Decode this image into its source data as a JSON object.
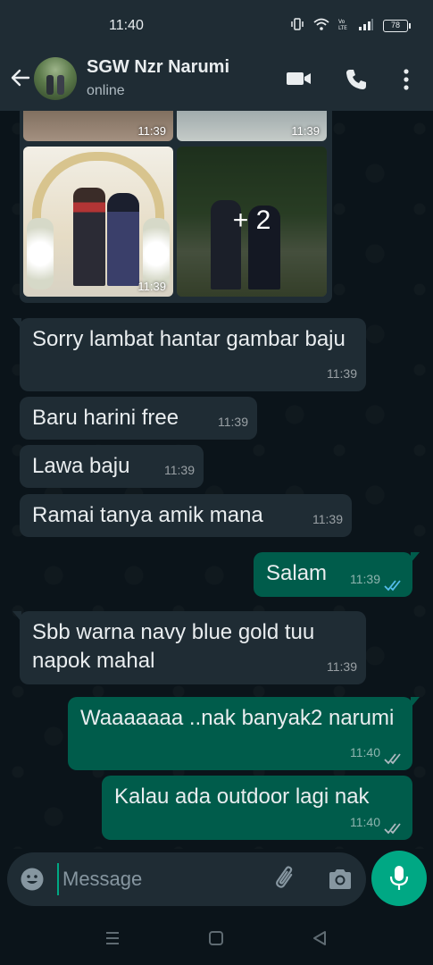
{
  "status_bar": {
    "time": "11:40",
    "battery": "78"
  },
  "header": {
    "name": "SGW Nzr Narumi",
    "status": "online"
  },
  "media": {
    "photo_times": [
      "11:39",
      "11:39",
      "11:39"
    ],
    "more_count": "+ 2"
  },
  "messages": [
    {
      "direction": "in",
      "text": "Sorry lambat hantar gambar baju",
      "time": "11:39"
    },
    {
      "direction": "in",
      "text": "Baru harini free",
      "time": "11:39"
    },
    {
      "direction": "in",
      "text": "Lawa baju",
      "time": "11:39"
    },
    {
      "direction": "in",
      "text": "Ramai tanya amik mana",
      "time": "11:39"
    },
    {
      "direction": "out",
      "text": "Salam",
      "time": "11:39",
      "ticks": "read"
    },
    {
      "direction": "in",
      "text": "Sbb warna navy blue gold tuu napok mahal",
      "time": "11:39"
    },
    {
      "direction": "out",
      "text": "Waaaaaaa ..nak banyak2 narumi",
      "time": "11:40",
      "ticks": "delivered"
    },
    {
      "direction": "out",
      "text": "Kalau ada outdoor lagi nak",
      "time": "11:40",
      "ticks": "delivered"
    }
  ],
  "composer": {
    "placeholder": "Message"
  },
  "colors": {
    "incoming": "#1f2c34",
    "outgoing": "#005c4b",
    "accent": "#00a884",
    "read_tick": "#53bdeb"
  },
  "icons": [
    "back-arrow-icon",
    "video-call-icon",
    "phone-icon",
    "more-vert-icon",
    "emoji-icon",
    "attach-icon",
    "camera-icon",
    "mic-icon"
  ]
}
